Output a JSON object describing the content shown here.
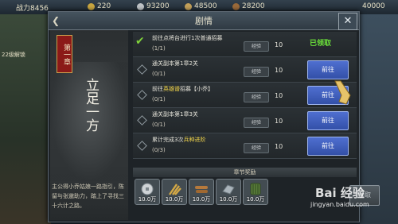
{
  "hud": {
    "power": "战力8456",
    "resources": [
      "220",
      "93200",
      "48500",
      "28200"
    ],
    "right_value": "40000",
    "left_hint": "22级解锁"
  },
  "dialog": {
    "title": "剧情",
    "back_icon": "back-arrow-icon",
    "close_icon": "close-icon"
  },
  "chapter": {
    "badge": "第一章",
    "title": "立足一方",
    "description": "主公得小乔姑娘一路指引，陈留与张邈助力，踏上了寻找三十六计之路。"
  },
  "quests": [
    {
      "name": "前往点将台进行1次普通招募",
      "highlight": "",
      "suffix": "",
      "progress": "(1/1)",
      "exp_label": "经验",
      "exp": "10",
      "status": "已领取",
      "done": true
    },
    {
      "name": "通关副本第1章2关",
      "highlight": "",
      "suffix": "",
      "progress": "(0/1)",
      "exp_label": "经验",
      "exp": "10",
      "button": "前往",
      "done": false
    },
    {
      "name": "前往",
      "highlight": "英雄谱",
      "suffix": "招募【小乔】",
      "progress": "(0/1)",
      "exp_label": "经验",
      "exp": "10",
      "button": "前往",
      "done": false
    },
    {
      "name": "通关副本第1章3关",
      "highlight": "",
      "suffix": "",
      "progress": "(0/1)",
      "exp_label": "经验",
      "exp": "10",
      "button": "前往",
      "done": false
    },
    {
      "name": "累计完成3次",
      "highlight": "兵种进阶",
      "suffix": "",
      "progress": "(0/3)",
      "exp_label": "经验",
      "exp": "10",
      "button": "前往",
      "done": false
    }
  ],
  "rewards": {
    "label": "章节奖励",
    "items": [
      {
        "icon": "silver-coin-icon",
        "amount": "10.0万"
      },
      {
        "icon": "grain-icon",
        "amount": "10.0万"
      },
      {
        "icon": "wood-icon",
        "amount": "10.0万"
      },
      {
        "icon": "iron-icon",
        "amount": "10.0万"
      },
      {
        "icon": "bamboo-scroll-icon",
        "amount": "10.0万"
      }
    ],
    "claim_label": "领取"
  },
  "watermark": {
    "text": "Bai 经验",
    "url": "jingyan.baidu.com"
  },
  "colors": {
    "accent_blue": "#3f5fc0",
    "received_green": "#6be23a",
    "highlight_yellow": "#f3d64a",
    "chapter_red": "#8b1a18"
  }
}
